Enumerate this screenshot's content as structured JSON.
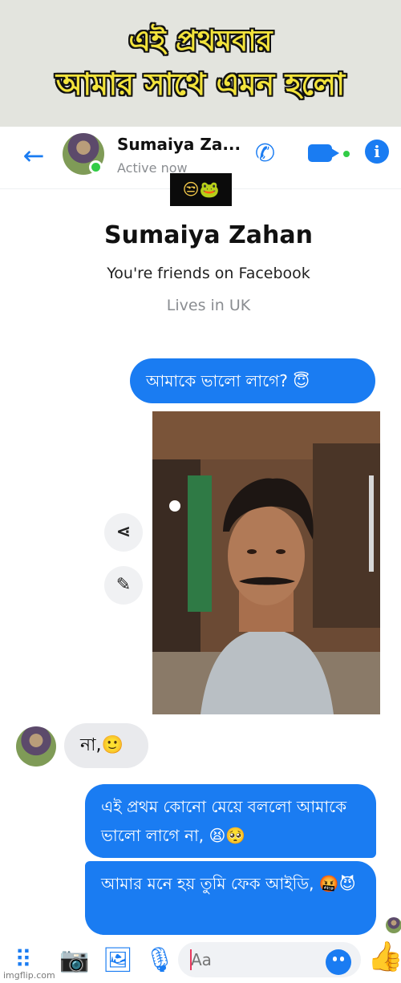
{
  "meme_caption": {
    "line1": "এই প্রথমবার",
    "line2": "আমার সাথে এমন হলো"
  },
  "header": {
    "contact_name": "Sumaiya Za...",
    "status": "Active now",
    "censor_emojis": "😒🐸"
  },
  "profile": {
    "name": "Sumaiya Zahan",
    "friends_text": "You're friends on Facebook",
    "lives_text": "Lives in UK"
  },
  "messages": [
    {
      "from": "me",
      "text": "আমাকে ভালো লাগে? 😇"
    },
    {
      "from": "me",
      "type": "photo"
    },
    {
      "from": "them",
      "text": "না,🙂"
    },
    {
      "from": "me",
      "text": "এই প্রথম কোনো মেয়ে বললো আমাকে ভালো লাগে না, 😫🥺"
    },
    {
      "from": "me",
      "text": "আমার মনে হয় তুমি ফেক আইডি, 🤬😈"
    }
  ],
  "composer": {
    "placeholder": "Aa"
  },
  "watermark": "imgflip.com",
  "colors": {
    "accent": "#1a7cf2",
    "online": "#31cc46",
    "incoming_bubble": "#e9eaed",
    "caption_fill": "#f2e33c"
  }
}
